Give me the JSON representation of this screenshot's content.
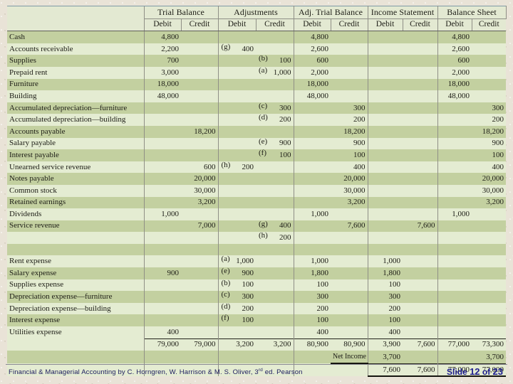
{
  "slide": {
    "credit_line": "Financial & Managerial Accounting by C. Horngren, W. Harrison & M. S. Oliver, 3",
    "credit_ordinal": "rd",
    "credit_tail": " ed. Pearson",
    "counter_prefix": "Slide ",
    "counter_current": "12",
    "counter_mid": " of ",
    "counter_total": "23",
    "accent_color": "#1d1d8f",
    "table_header_bg": "#e3e9d2",
    "row_dark": "#c3d0a0",
    "row_light": "#e4ecd2"
  },
  "worksheet": {
    "column_groups": [
      {
        "label": "Trial Balance"
      },
      {
        "label": "Adjustments"
      },
      {
        "label": "Adj. Trial Balance"
      },
      {
        "label": "Income Statement"
      },
      {
        "label": "Balance Sheet"
      }
    ],
    "sub_headers": [
      "Debit",
      "Credit",
      "Debit",
      "Credit",
      "Debit",
      "Credit",
      "Debit",
      "Credit",
      "Debit",
      "Credit"
    ],
    "net_income_label": "Net Income",
    "rows": [
      {
        "account": "Cash",
        "tb_debit": "4,800",
        "tb_credit": "",
        "adj_debit_ref": "",
        "adj_debit": "",
        "adj_credit_ref": "",
        "adj_credit": "",
        "atb_debit": "4,800",
        "atb_credit": "",
        "is_debit": "",
        "is_credit": "",
        "bs_debit": "4,800",
        "bs_credit": ""
      },
      {
        "account": "Accounts receivable",
        "tb_debit": "2,200",
        "tb_credit": "",
        "adj_debit_ref": "(g)",
        "adj_debit": "400",
        "adj_credit_ref": "",
        "adj_credit": "",
        "atb_debit": "2,600",
        "atb_credit": "",
        "is_debit": "",
        "is_credit": "",
        "bs_debit": "2,600",
        "bs_credit": ""
      },
      {
        "account": "Supplies",
        "tb_debit": "700",
        "tb_credit": "",
        "adj_debit_ref": "",
        "adj_debit": "",
        "adj_credit_ref": "(b)",
        "adj_credit": "100",
        "atb_debit": "600",
        "atb_credit": "",
        "is_debit": "",
        "is_credit": "",
        "bs_debit": "600",
        "bs_credit": ""
      },
      {
        "account": "Prepaid rent",
        "tb_debit": "3,000",
        "tb_credit": "",
        "adj_debit_ref": "",
        "adj_debit": "",
        "adj_credit_ref": "(a)",
        "adj_credit": "1,000",
        "atb_debit": "2,000",
        "atb_credit": "",
        "is_debit": "",
        "is_credit": "",
        "bs_debit": "2,000",
        "bs_credit": ""
      },
      {
        "account": "Furniture",
        "tb_debit": "18,000",
        "tb_credit": "",
        "adj_debit_ref": "",
        "adj_debit": "",
        "adj_credit_ref": "",
        "adj_credit": "",
        "atb_debit": "18,000",
        "atb_credit": "",
        "is_debit": "",
        "is_credit": "",
        "bs_debit": "18,000",
        "bs_credit": ""
      },
      {
        "account": "Building",
        "tb_debit": "48,000",
        "tb_credit": "",
        "adj_debit_ref": "",
        "adj_debit": "",
        "adj_credit_ref": "",
        "adj_credit": "",
        "atb_debit": "48,000",
        "atb_credit": "",
        "is_debit": "",
        "is_credit": "",
        "bs_debit": "48,000",
        "bs_credit": ""
      },
      {
        "account": "Accumulated depreciation—furniture",
        "tb_debit": "",
        "tb_credit": "",
        "adj_debit_ref": "",
        "adj_debit": "",
        "adj_credit_ref": "(c)",
        "adj_credit": "300",
        "atb_debit": "",
        "atb_credit": "300",
        "is_debit": "",
        "is_credit": "",
        "bs_debit": "",
        "bs_credit": "300"
      },
      {
        "account": "Accumulated depreciation—building",
        "tb_debit": "",
        "tb_credit": "",
        "adj_debit_ref": "",
        "adj_debit": "",
        "adj_credit_ref": "(d)",
        "adj_credit": "200",
        "atb_debit": "",
        "atb_credit": "200",
        "is_debit": "",
        "is_credit": "",
        "bs_debit": "",
        "bs_credit": "200"
      },
      {
        "account": "Accounts payable",
        "tb_debit": "",
        "tb_credit": "18,200",
        "adj_debit_ref": "",
        "adj_debit": "",
        "adj_credit_ref": "",
        "adj_credit": "",
        "atb_debit": "",
        "atb_credit": "18,200",
        "is_debit": "",
        "is_credit": "",
        "bs_debit": "",
        "bs_credit": "18,200"
      },
      {
        "account": "Salary payable",
        "tb_debit": "",
        "tb_credit": "",
        "adj_debit_ref": "",
        "adj_debit": "",
        "adj_credit_ref": "(e)",
        "adj_credit": "900",
        "atb_debit": "",
        "atb_credit": "900",
        "is_debit": "",
        "is_credit": "",
        "bs_debit": "",
        "bs_credit": "900"
      },
      {
        "account": "Interest payable",
        "tb_debit": "",
        "tb_credit": "",
        "adj_debit_ref": "",
        "adj_debit": "",
        "adj_credit_ref": "(f)",
        "adj_credit": "100",
        "atb_debit": "",
        "atb_credit": "100",
        "is_debit": "",
        "is_credit": "",
        "bs_debit": "",
        "bs_credit": "100"
      },
      {
        "account": "Unearned service revenue",
        "tb_debit": "",
        "tb_credit": "600",
        "adj_debit_ref": "(h)",
        "adj_debit": "200",
        "adj_credit_ref": "",
        "adj_credit": "",
        "atb_debit": "",
        "atb_credit": "400",
        "is_debit": "",
        "is_credit": "",
        "bs_debit": "",
        "bs_credit": "400"
      },
      {
        "account": "Notes payable",
        "tb_debit": "",
        "tb_credit": "20,000",
        "adj_debit_ref": "",
        "adj_debit": "",
        "adj_credit_ref": "",
        "adj_credit": "",
        "atb_debit": "",
        "atb_credit": "20,000",
        "is_debit": "",
        "is_credit": "",
        "bs_debit": "",
        "bs_credit": "20,000"
      },
      {
        "account": "Common stock",
        "tb_debit": "",
        "tb_credit": "30,000",
        "adj_debit_ref": "",
        "adj_debit": "",
        "adj_credit_ref": "",
        "adj_credit": "",
        "atb_debit": "",
        "atb_credit": "30,000",
        "is_debit": "",
        "is_credit": "",
        "bs_debit": "",
        "bs_credit": "30,000"
      },
      {
        "account": "Retained earnings",
        "tb_debit": "",
        "tb_credit": "3,200",
        "adj_debit_ref": "",
        "adj_debit": "",
        "adj_credit_ref": "",
        "adj_credit": "",
        "atb_debit": "",
        "atb_credit": "3,200",
        "is_debit": "",
        "is_credit": "",
        "bs_debit": "",
        "bs_credit": "3,200"
      },
      {
        "account": "Dividends",
        "tb_debit": "1,000",
        "tb_credit": "",
        "adj_debit_ref": "",
        "adj_debit": "",
        "adj_credit_ref": "",
        "adj_credit": "",
        "atb_debit": "1,000",
        "atb_credit": "",
        "is_debit": "",
        "is_credit": "",
        "bs_debit": "1,000",
        "bs_credit": ""
      },
      {
        "account": "Service revenue",
        "tb_debit": "",
        "tb_credit": "7,000",
        "adj_debit_ref": "",
        "adj_debit": "",
        "adj_credit_ref": "(g)",
        "adj_credit": "400",
        "atb_debit": "",
        "atb_credit": "7,600",
        "is_debit": "",
        "is_credit": "7,600",
        "bs_debit": "",
        "bs_credit": ""
      },
      {
        "account": "",
        "tb_debit": "",
        "tb_credit": "",
        "adj_debit_ref": "",
        "adj_debit": "",
        "adj_credit_ref": "(h)",
        "adj_credit": "200",
        "atb_debit": "",
        "atb_credit": "",
        "is_debit": "",
        "is_credit": "",
        "bs_debit": "",
        "bs_credit": ""
      },
      {
        "account": "",
        "tb_debit": "",
        "tb_credit": "",
        "adj_debit_ref": "",
        "adj_debit": "",
        "adj_credit_ref": "",
        "adj_credit": "",
        "atb_debit": "",
        "atb_credit": "",
        "is_debit": "",
        "is_credit": "",
        "bs_debit": "",
        "bs_credit": ""
      },
      {
        "account": "Rent expense",
        "tb_debit": "",
        "tb_credit": "",
        "adj_debit_ref": "(a)",
        "adj_debit": "1,000",
        "adj_credit_ref": "",
        "adj_credit": "",
        "atb_debit": "1,000",
        "atb_credit": "",
        "is_debit": "1,000",
        "is_credit": "",
        "bs_debit": "",
        "bs_credit": ""
      },
      {
        "account": "Salary expense",
        "tb_debit": "900",
        "tb_credit": "",
        "adj_debit_ref": "(e)",
        "adj_debit": "900",
        "adj_credit_ref": "",
        "adj_credit": "",
        "atb_debit": "1,800",
        "atb_credit": "",
        "is_debit": "1,800",
        "is_credit": "",
        "bs_debit": "",
        "bs_credit": ""
      },
      {
        "account": "Supplies expense",
        "tb_debit": "",
        "tb_credit": "",
        "adj_debit_ref": "(b)",
        "adj_debit": "100",
        "adj_credit_ref": "",
        "adj_credit": "",
        "atb_debit": "100",
        "atb_credit": "",
        "is_debit": "100",
        "is_credit": "",
        "bs_debit": "",
        "bs_credit": ""
      },
      {
        "account": "Depreciation expense—furniture",
        "tb_debit": "",
        "tb_credit": "",
        "adj_debit_ref": "(c)",
        "adj_debit": "300",
        "adj_credit_ref": "",
        "adj_credit": "",
        "atb_debit": "300",
        "atb_credit": "",
        "is_debit": "300",
        "is_credit": "",
        "bs_debit": "",
        "bs_credit": ""
      },
      {
        "account": "Depreciation expense—building",
        "tb_debit": "",
        "tb_credit": "",
        "adj_debit_ref": "(d)",
        "adj_debit": "200",
        "adj_credit_ref": "",
        "adj_credit": "",
        "atb_debit": "200",
        "atb_credit": "",
        "is_debit": "200",
        "is_credit": "",
        "bs_debit": "",
        "bs_credit": ""
      },
      {
        "account": "Interest expense",
        "tb_debit": "",
        "tb_credit": "",
        "adj_debit_ref": "(f)",
        "adj_debit": "100",
        "adj_credit_ref": "",
        "adj_credit": "",
        "atb_debit": "100",
        "atb_credit": "",
        "is_debit": "100",
        "is_credit": "",
        "bs_debit": "",
        "bs_credit": ""
      },
      {
        "account": "Utilities expense",
        "tb_debit": "400",
        "tb_credit": "",
        "adj_debit_ref": "",
        "adj_debit": "",
        "adj_credit_ref": "",
        "adj_credit": "",
        "atb_debit": "400",
        "atb_credit": "",
        "is_debit": "400",
        "is_credit": "",
        "bs_debit": "",
        "bs_credit": ""
      }
    ],
    "totals": {
      "tb_debit": "79,000",
      "tb_credit": "79,000",
      "adj_debit": "3,200",
      "adj_credit": "3,200",
      "atb_debit": "80,900",
      "atb_credit": "80,900",
      "is_debit": "3,900",
      "is_credit": "7,600",
      "bs_debit": "77,000",
      "bs_credit": "73,300"
    },
    "net_income": {
      "is_debit": "3,700",
      "is_credit": "",
      "bs_debit": "",
      "bs_credit": "3,700"
    },
    "grand_totals": {
      "is_debit": "7,600",
      "is_credit": "7,600",
      "bs_debit": "77,000",
      "bs_credit": "77,000"
    }
  }
}
